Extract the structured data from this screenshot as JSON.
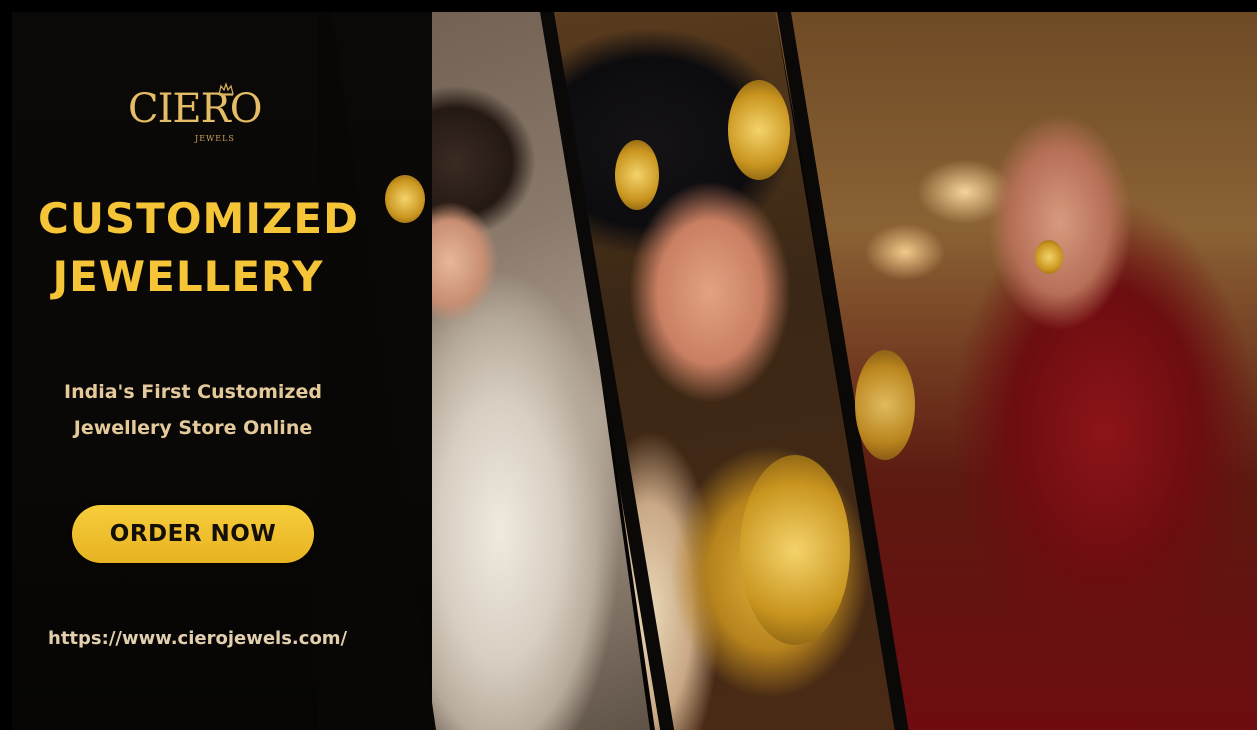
{
  "brand": {
    "logo_text": "CIERO",
    "logo_subtext": "JEWELS"
  },
  "headline": {
    "line1": "CUSTOMIZED",
    "line2": "JEWELLERY"
  },
  "tagline": {
    "line1": "India's First Customized",
    "line2": "Jewellery Store Online"
  },
  "cta": {
    "label": "ORDER NOW"
  },
  "website": {
    "url": "https://www.cierojewels.com/"
  },
  "colors": {
    "accent_gold": "#f6c437",
    "button": "#f0c12e",
    "background": "#0a0806"
  },
  "photos": [
    "bride-ivory-dupatta",
    "bride-gold-necklace",
    "bride-red-lehenga"
  ]
}
